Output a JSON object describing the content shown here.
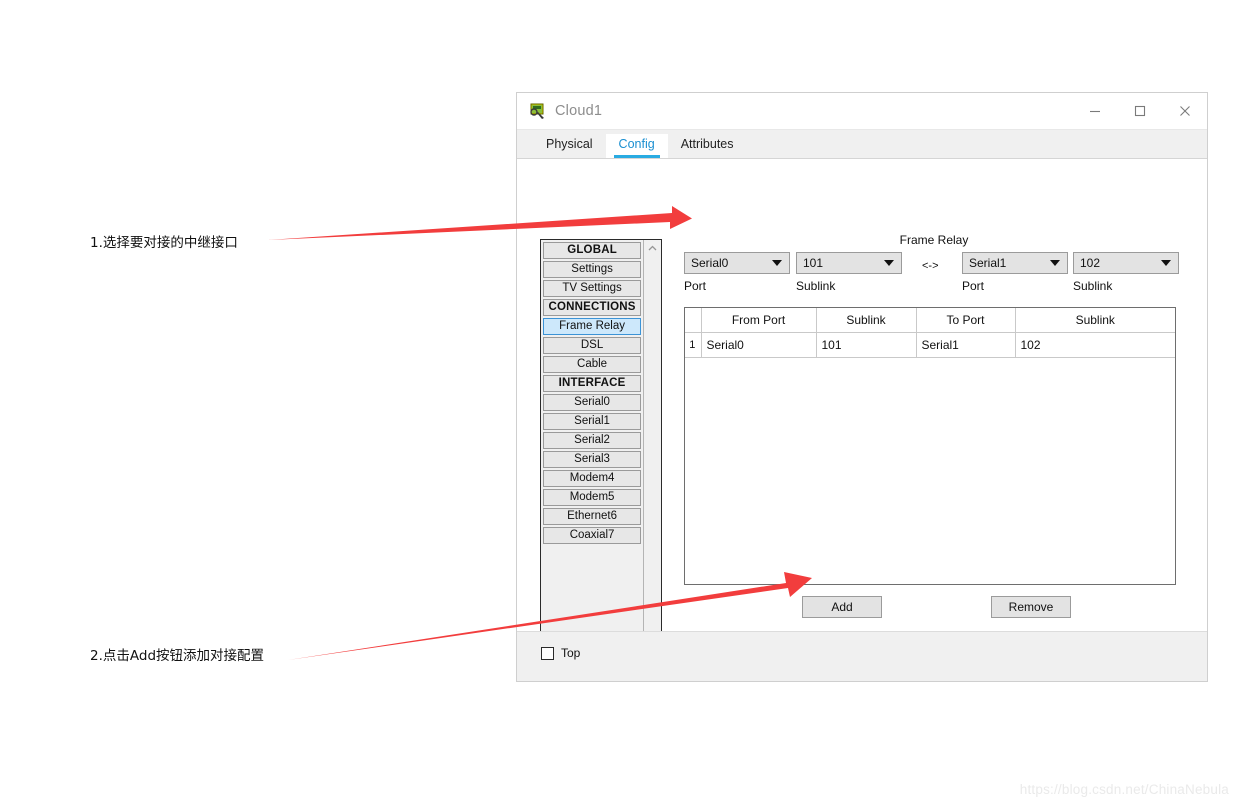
{
  "window": {
    "title": "Cloud1",
    "icon": "cloud-device-icon",
    "controls": {
      "minimize": "minimize-icon",
      "maximize": "maximize-icon",
      "close": "close-icon"
    }
  },
  "tabs": [
    {
      "label": "Physical",
      "active": false
    },
    {
      "label": "Config",
      "active": true
    },
    {
      "label": "Attributes",
      "active": false
    }
  ],
  "sidebar": {
    "items": [
      {
        "label": "GLOBAL",
        "type": "header"
      },
      {
        "label": "Settings",
        "type": "item"
      },
      {
        "label": "TV Settings",
        "type": "item"
      },
      {
        "label": "CONNECTIONS",
        "type": "header"
      },
      {
        "label": "Frame Relay",
        "type": "item",
        "selected": true
      },
      {
        "label": "DSL",
        "type": "item"
      },
      {
        "label": "Cable",
        "type": "item"
      },
      {
        "label": "INTERFACE",
        "type": "header"
      },
      {
        "label": "Serial0",
        "type": "item"
      },
      {
        "label": "Serial1",
        "type": "item"
      },
      {
        "label": "Serial2",
        "type": "item"
      },
      {
        "label": "Serial3",
        "type": "item"
      },
      {
        "label": "Modem4",
        "type": "item"
      },
      {
        "label": "Modem5",
        "type": "item"
      },
      {
        "label": "Ethernet6",
        "type": "item"
      },
      {
        "label": "Coaxial7",
        "type": "item"
      }
    ],
    "scroll_up_icon": "chevron-up-icon",
    "scroll_down_icon": "chevron-down-icon"
  },
  "frame_relay": {
    "title": "Frame Relay",
    "link_symbol": "<->",
    "from_port_select": {
      "value": "Serial0",
      "caption": "Port"
    },
    "from_sublink_select": {
      "value": "101",
      "caption": "Sublink"
    },
    "to_port_select": {
      "value": "Serial1",
      "caption": "Port"
    },
    "to_sublink_select": {
      "value": "102",
      "caption": "Sublink"
    },
    "table": {
      "columns": [
        "",
        "From Port",
        "Sublink",
        "To Port",
        "Sublink"
      ],
      "rows": [
        {
          "index": "1",
          "from_port": "Serial0",
          "from_sublink": "101",
          "to_port": "Serial1",
          "to_sublink": "102"
        }
      ]
    },
    "add_button": "Add",
    "remove_button": "Remove"
  },
  "footer": {
    "top_checkbox_label": "Top",
    "top_checkbox_checked": false
  },
  "annotations": [
    {
      "id": "step-1",
      "text": "1.选择要对接的中继接口"
    },
    {
      "id": "step-2",
      "text": "2.点击Add按钮添加对接配置"
    }
  ],
  "watermark": "https://blog.csdn.net/ChinaNebula",
  "colors": {
    "accent_tab": "#29abe2",
    "selection": "#cde8fb",
    "selection_border": "#3b93d6",
    "annotation_arrow": "#f23d3d",
    "control_face": "#e3e3e3",
    "panel_bg": "#f0f0f0"
  }
}
